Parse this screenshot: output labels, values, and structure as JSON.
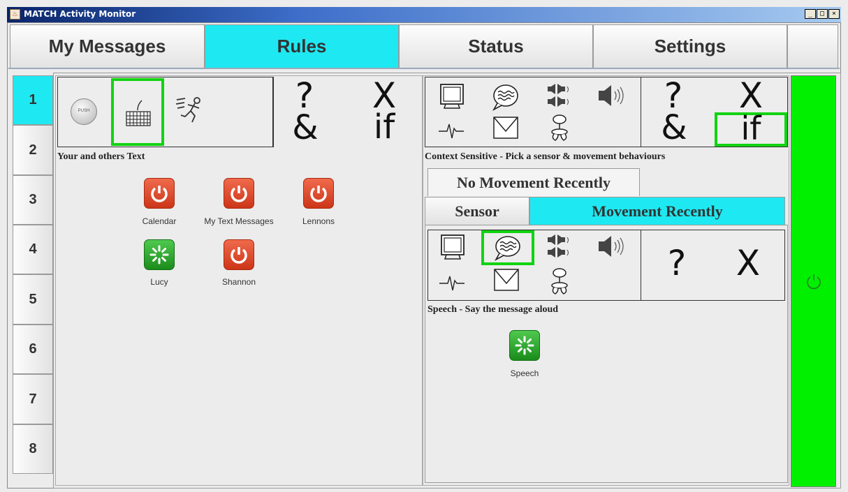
{
  "window": {
    "title": "MATCH Activity Monitor",
    "controls": [
      "_",
      "□",
      "×"
    ]
  },
  "main_tabs": [
    {
      "label": "My Messages"
    },
    {
      "label": "Rules"
    },
    {
      "label": "Status"
    },
    {
      "label": "Settings"
    }
  ],
  "rule_tabs": [
    "1",
    "2",
    "3",
    "4",
    "5",
    "6",
    "7",
    "8"
  ],
  "left_panel": {
    "symbols": {
      "question": "?",
      "cross": "X",
      "and": "&",
      "if": "if"
    },
    "caption": "Your and others Text",
    "apps": [
      {
        "label": "Calendar",
        "status": "red"
      },
      {
        "label": "My Text Messages",
        "status": "red"
      },
      {
        "label": "Lennons",
        "status": "red"
      },
      {
        "label": "Lucy",
        "status": "green"
      },
      {
        "label": "Shannon",
        "status": "red"
      }
    ]
  },
  "right_panel": {
    "symbols": {
      "question": "?",
      "cross": "X",
      "and": "&",
      "if": "if"
    },
    "caption": "Context Sensitive - Pick a sensor & movement behaviours",
    "sub_tabs": {
      "no_movement": "No Movement Recently",
      "sensor": "Sensor",
      "movement": "Movement Recently"
    },
    "inner_symbols": {
      "question": "?",
      "cross": "X"
    },
    "inner_caption": "Speech - Say the message aloud",
    "inner_apps": [
      {
        "label": "Speech",
        "status": "green"
      }
    ]
  },
  "colors": {
    "active_tab": "#1ee9f2",
    "power_bar": "#00f000",
    "selection": "#12d312"
  }
}
